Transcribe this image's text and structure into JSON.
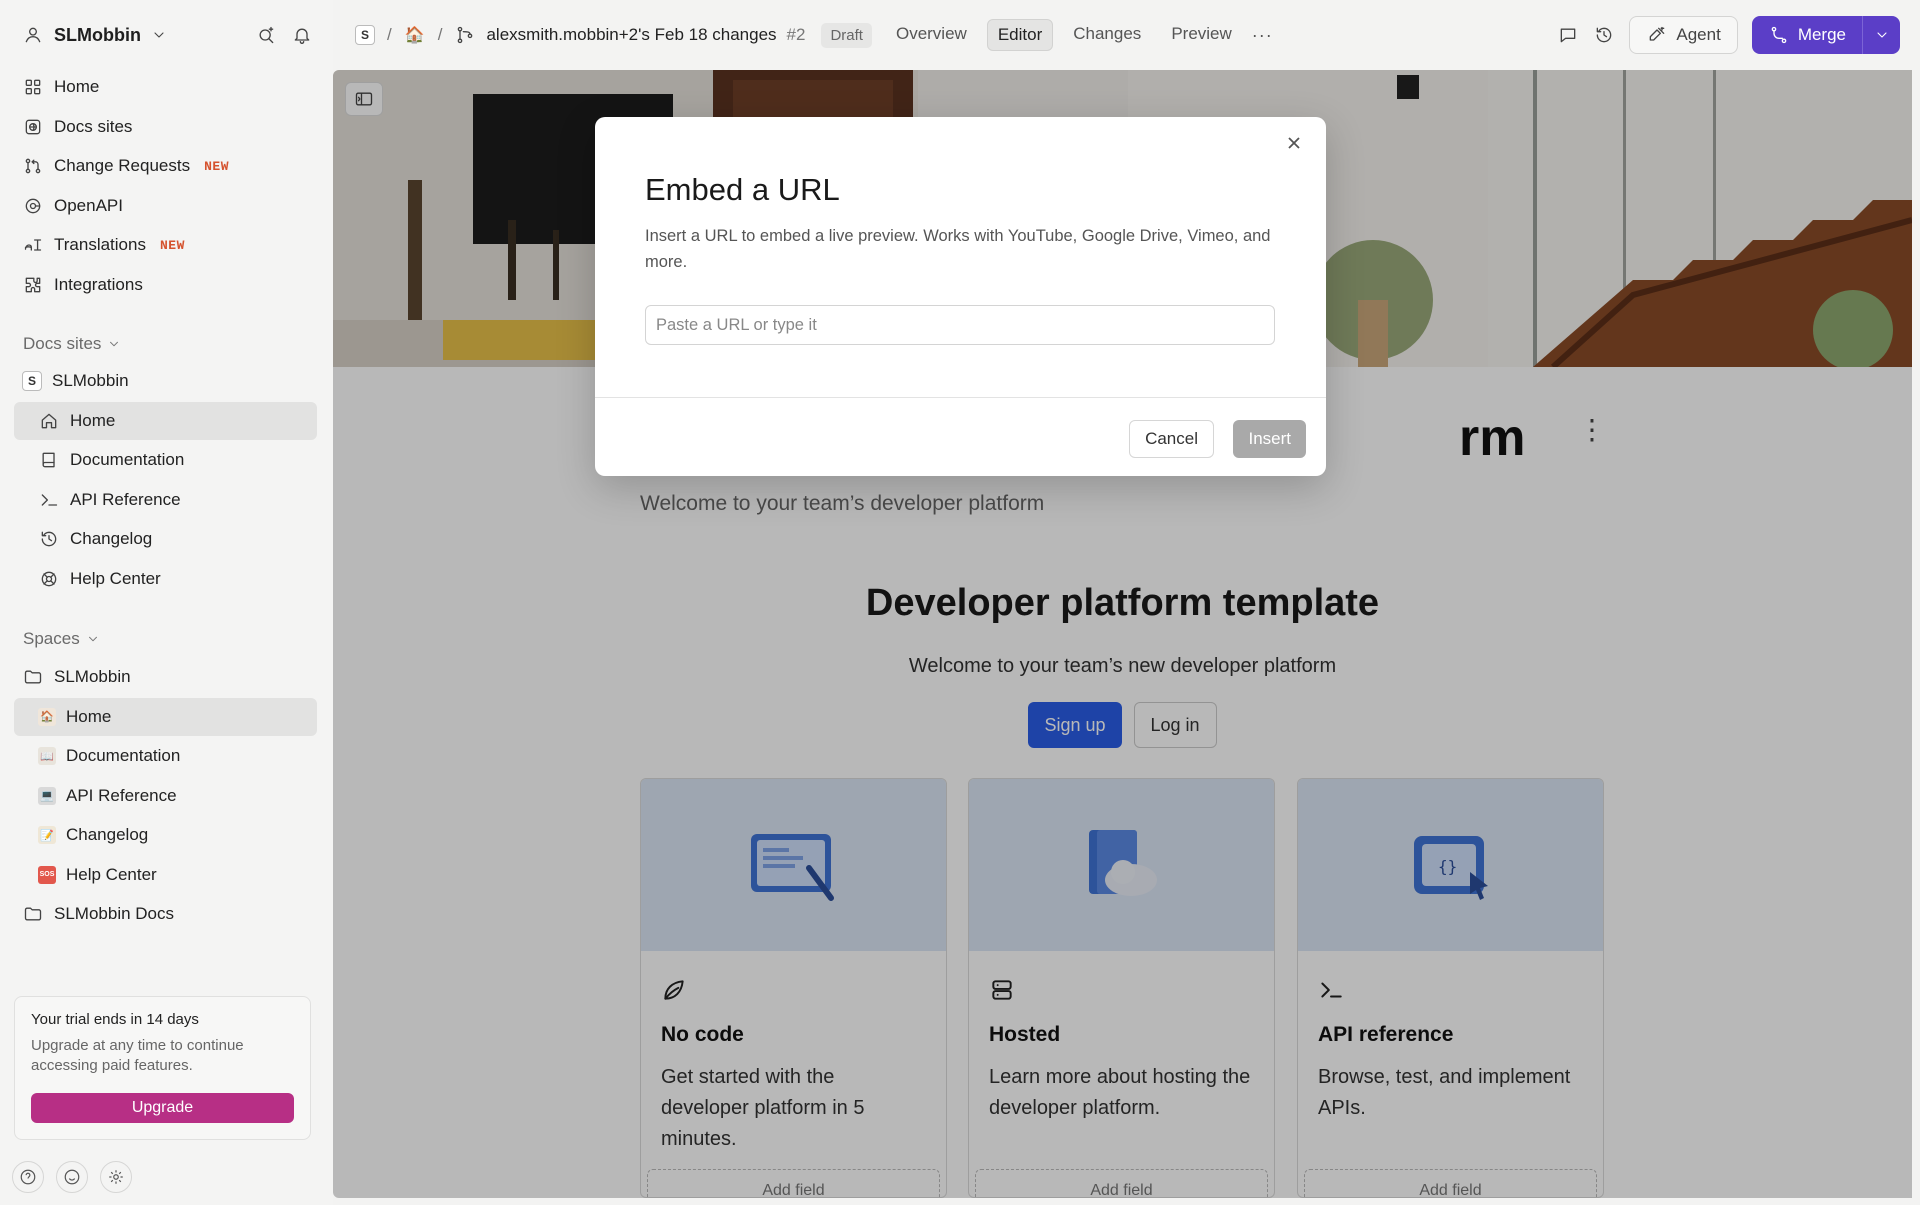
{
  "sidebar": {
    "org_name": "SLMobbin",
    "nav": [
      {
        "label": "Home",
        "icon": "grid-icon"
      },
      {
        "label": "Docs sites",
        "icon": "docs-sites-icon"
      },
      {
        "label": "Change Requests",
        "icon": "change-requests-icon",
        "badge": "NEW"
      },
      {
        "label": "OpenAPI",
        "icon": "openapi-icon"
      },
      {
        "label": "Translations",
        "icon": "translations-icon",
        "badge": "NEW"
      },
      {
        "label": "Integrations",
        "icon": "puzzle-icon"
      }
    ],
    "docs_sites_header": "Docs sites",
    "docs_site": {
      "initial": "S",
      "name": "SLMobbin",
      "items": [
        {
          "label": "Home",
          "icon": "house-icon"
        },
        {
          "label": "Documentation",
          "icon": "book-icon"
        },
        {
          "label": "API Reference",
          "icon": "terminal-icon"
        },
        {
          "label": "Changelog",
          "icon": "history-icon"
        },
        {
          "label": "Help Center",
          "icon": "lifebuoy-icon"
        }
      ]
    },
    "spaces_header": "Spaces",
    "space": {
      "name": "SLMobbin",
      "items": [
        {
          "label": "Home",
          "icon": "home-emoji-icon"
        },
        {
          "label": "Documentation",
          "icon": "book-emoji-icon"
        },
        {
          "label": "API Reference",
          "icon": "computer-emoji-icon"
        },
        {
          "label": "Changelog",
          "icon": "pencil-emoji-icon"
        },
        {
          "label": "Help Center",
          "icon": "sos-emoji-icon"
        }
      ]
    },
    "space2_name": "SLMobbin Docs",
    "trial": {
      "title": "Your trial ends in 14 days",
      "body": "Upgrade at any time to continue accessing paid features.",
      "button": "Upgrade"
    }
  },
  "topbar": {
    "space_initial": "S",
    "branch": "alexsmith.mobbin+2's Feb 18 changes",
    "number": "#2",
    "status": "Draft",
    "tabs": [
      "Overview",
      "Editor",
      "Changes",
      "Preview"
    ],
    "more": "···",
    "agent": "Agent",
    "merge": "Merge"
  },
  "page": {
    "title_visible": "rm",
    "subtitle": "Welcome to your team’s developer platform",
    "hero_title": "Developer platform template",
    "hero_sub": "Welcome to your team’s new developer platform",
    "signup": "Sign up",
    "login": "Log in",
    "cards": [
      {
        "title": "No code",
        "desc": "Get started with the developer platform in 5 minutes.",
        "icon": "leaf-icon",
        "add": "Add field"
      },
      {
        "title": "Hosted",
        "desc": "Learn more about hosting the developer platform.",
        "icon": "server-icon",
        "add": "Add field"
      },
      {
        "title": "API reference",
        "desc": "Browse, test, and implement APIs.",
        "icon": "terminal-icon",
        "add": "Add field"
      }
    ]
  },
  "modal": {
    "title": "Embed a URL",
    "description": "Insert a URL to embed a live preview. Works with YouTube, Google Drive, Vimeo, and more.",
    "placeholder": "Paste a URL or type it",
    "cancel": "Cancel",
    "insert": "Insert"
  }
}
